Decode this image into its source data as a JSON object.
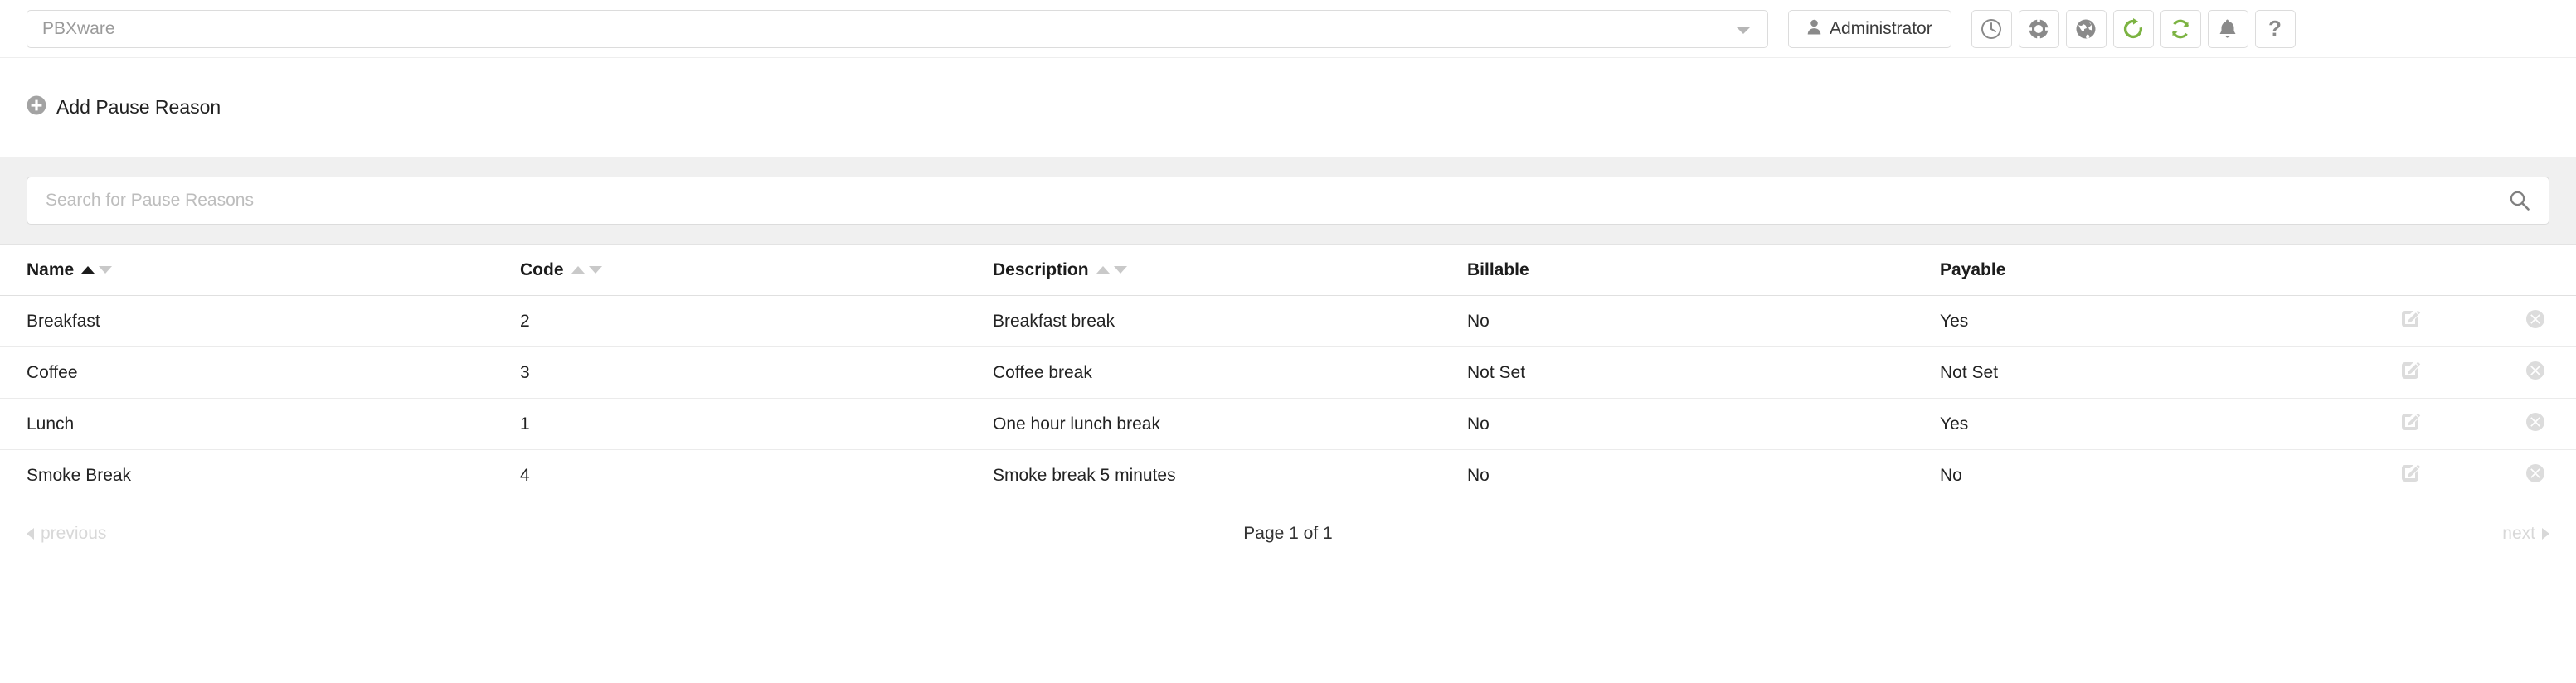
{
  "header": {
    "server_select": {
      "value": "PBXware",
      "icon": "chevron-down-icon"
    },
    "admin_button": {
      "label": "Administrator",
      "icon": "user-icon"
    },
    "icon_buttons": [
      {
        "name": "clock-icon",
        "title": "Clock"
      },
      {
        "name": "life-ring-icon",
        "title": "Support"
      },
      {
        "name": "globe-icon",
        "title": "Globe"
      },
      {
        "name": "refresh-icon",
        "title": "Reload",
        "color": "#7cb342"
      },
      {
        "name": "sync-icon",
        "title": "Sync",
        "color": "#7cb342"
      },
      {
        "name": "bell-icon",
        "title": "Notifications"
      },
      {
        "name": "help-icon",
        "title": "Help",
        "glyph": "?"
      }
    ]
  },
  "toolbar": {
    "add_label": "Add Pause Reason",
    "add_icon": "plus-circle-icon"
  },
  "search": {
    "placeholder": "Search for Pause Reasons",
    "value": "",
    "icon": "search-icon"
  },
  "table": {
    "columns": [
      {
        "key": "name",
        "label": "Name",
        "sortable": true,
        "sort": "asc"
      },
      {
        "key": "code",
        "label": "Code",
        "sortable": true,
        "sort": "none"
      },
      {
        "key": "description",
        "label": "Description",
        "sortable": true,
        "sort": "none"
      },
      {
        "key": "billable",
        "label": "Billable",
        "sortable": false,
        "sort": "none"
      },
      {
        "key": "payable",
        "label": "Payable",
        "sortable": false,
        "sort": "none"
      }
    ],
    "rows": [
      {
        "name": "Breakfast",
        "code": "2",
        "description": "Breakfast break",
        "billable": "No",
        "payable": "Yes"
      },
      {
        "name": "Coffee",
        "code": "3",
        "description": "Coffee break",
        "billable": "Not Set",
        "payable": "Not Set"
      },
      {
        "name": "Lunch",
        "code": "1",
        "description": "One hour lunch break",
        "billable": "No",
        "payable": "Yes"
      },
      {
        "name": "Smoke Break",
        "code": "4",
        "description": "Smoke break 5 minutes",
        "billable": "No",
        "payable": "No"
      }
    ],
    "row_actions": {
      "edit_icon": "edit-pencil-icon",
      "delete_icon": "delete-circle-icon"
    }
  },
  "pagination": {
    "previous_label": "previous",
    "page_label": "Page 1 of 1",
    "next_label": "next"
  },
  "colors": {
    "accent_green": "#7cb342",
    "band_gray": "#f0f0f0",
    "text_dark": "#222222",
    "muted": "#bdbdbd"
  }
}
